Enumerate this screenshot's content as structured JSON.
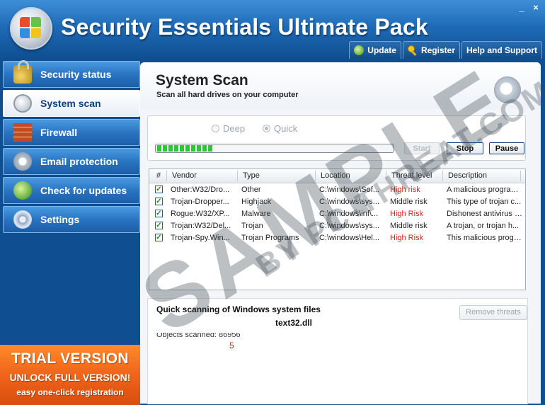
{
  "window": {
    "title": "Security Essentials Ultimate Pack",
    "minimize": "_",
    "close": "×"
  },
  "top_buttons": [
    {
      "label": "Update",
      "icon": "update-icon"
    },
    {
      "label": "Register",
      "icon": "key-icon"
    },
    {
      "label": "Help and Support"
    }
  ],
  "sidebar": {
    "items": [
      {
        "label": "Security status",
        "icon": "lock-icon",
        "active": false
      },
      {
        "label": "System scan",
        "icon": "scan-icon",
        "active": true
      },
      {
        "label": "Firewall",
        "icon": "firewall-icon",
        "active": false
      },
      {
        "label": "Email protection",
        "icon": "email-icon",
        "active": false
      },
      {
        "label": "Check for updates",
        "icon": "update-icon",
        "active": false
      },
      {
        "label": "Settings",
        "icon": "gear-icon",
        "active": false
      }
    ]
  },
  "trial": {
    "line1": "TRIAL VERSION",
    "line2": "UNLOCK FULL VERSION!",
    "line3": "easy one-click registration"
  },
  "main": {
    "title": "System Scan",
    "subtitle": "Scan all hard drives on your computer",
    "scan_mode": {
      "deep": "Deep",
      "quick": "Quick",
      "selected": "Quick"
    },
    "progress": 0.24,
    "buttons": {
      "start": "Start",
      "stop": "Stop",
      "pause": "Pause"
    },
    "table": {
      "columns": [
        "#",
        "Vendor",
        "Type",
        "Location",
        "Threat level",
        "Description"
      ],
      "rows": [
        {
          "vendor": "Other:W32/Dro...",
          "type": "Other",
          "location": "C:\\windows\\Sof...",
          "threat": "High risk",
          "threat_red": true,
          "description": "A malicious program ..."
        },
        {
          "vendor": "Trojan-Dropper...",
          "type": "Highjack",
          "location": "C:\\windows\\sys...",
          "threat": "Middle risk",
          "threat_red": false,
          "description": "This type of trojan c..."
        },
        {
          "vendor": "Rogue:W32/XP...",
          "type": "Malware",
          "location": "C:\\windows\\inf\\...",
          "threat": "High Risk",
          "threat_red": true,
          "description": "Dishonest antivirus s..."
        },
        {
          "vendor": "Trojan:W32/Del...",
          "type": "Trojan",
          "location": "C:\\windows\\sys...",
          "threat": "Middle risk",
          "threat_red": false,
          "description": "A trojan, or trojan h..."
        },
        {
          "vendor": "Trojan-Spy.Win...",
          "type": "Trojan Programs",
          "location": "C:\\windows\\Hel...",
          "threat": "High Risk",
          "threat_red": true,
          "description": "This malicious progra..."
        }
      ]
    },
    "status": {
      "title": "Quick scanning of Windows system files",
      "file": "text32.dll",
      "objects_scanned": "Objects scanned: 86956",
      "count": "5",
      "remove_button": "Remove threats"
    }
  },
  "watermark": {
    "text": "SAMPLE",
    "sub": "BY PC-THREAT.COM"
  }
}
